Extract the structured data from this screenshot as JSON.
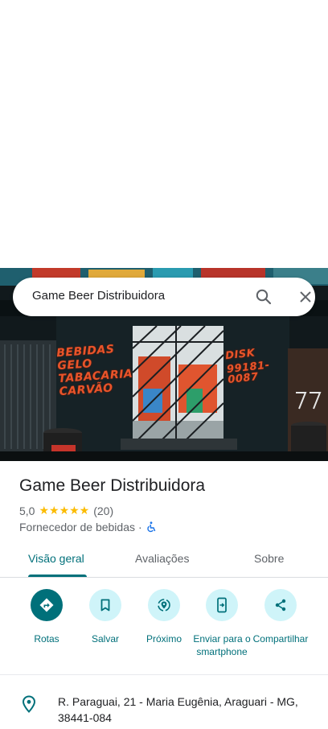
{
  "search": {
    "query": "Game Beer Distribuidora"
  },
  "hero": {
    "graffiti_left": [
      "BEBIDAS",
      "GELO",
      "TABACARIA",
      "CARVÃO"
    ],
    "graffiti_right": [
      "DISK",
      "99181-0087"
    ]
  },
  "place": {
    "title": "Game Beer Distribuidora",
    "rating": "5,0",
    "stars": "★★★★★",
    "review_count": "(20)",
    "category": "Fornecedor de bebidas",
    "separator": "·"
  },
  "tabs": [
    {
      "label": "Visão geral",
      "active": true
    },
    {
      "label": "Avaliações",
      "active": false
    },
    {
      "label": "Sobre",
      "active": false
    }
  ],
  "actions": [
    {
      "label": "Rotas",
      "icon": "directions-icon"
    },
    {
      "label": "Salvar",
      "icon": "bookmark-icon"
    },
    {
      "label": "Próximo",
      "icon": "nearby-icon"
    },
    {
      "label": "Enviar para o smartphone",
      "icon": "send-to-phone-icon"
    },
    {
      "label": "Compartilhar",
      "icon": "share-icon"
    }
  ],
  "address": {
    "text": "R. Paraguai, 21 - Maria Eugênia, Araguari - MG, 38441-084"
  },
  "colors": {
    "accent": "#00707a",
    "accent_light": "#cff4f9",
    "star": "#fbbc04",
    "text_secondary": "#5f6368"
  }
}
